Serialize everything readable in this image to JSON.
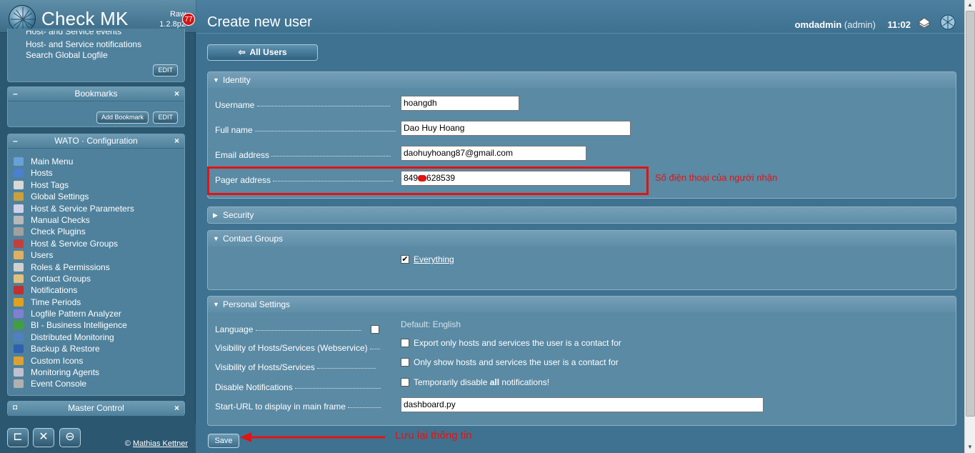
{
  "app": {
    "logo_text": "Check MK",
    "version_line1": "Raw",
    "version_line2": "1.2.8p2",
    "badge_count": "77"
  },
  "sidebar": {
    "top_snapin": {
      "cut_line": "Host- and Service events",
      "lines": [
        "Host- and Service notifications",
        "Search Global Logfile"
      ],
      "edit_label": "EDIT"
    },
    "bookmarks": {
      "title": "Bookmarks",
      "add_label": "Add Bookmark",
      "edit_label": "EDIT"
    },
    "wato": {
      "title": "WATO · Configuration",
      "items": [
        {
          "label": "Main Menu",
          "color": "#6aa0d8"
        },
        {
          "label": "Hosts",
          "color": "#4c7fd0"
        },
        {
          "label": "Host Tags",
          "color": "#d8d8d8"
        },
        {
          "label": "Global Settings",
          "color": "#c8a040"
        },
        {
          "label": "Host & Service Parameters",
          "color": "#d0d0e8"
        },
        {
          "label": "Manual Checks",
          "color": "#b8b8b8"
        },
        {
          "label": "Check Plugins",
          "color": "#a0a0a0"
        },
        {
          "label": "Host & Service Groups",
          "color": "#c04040"
        },
        {
          "label": "Users",
          "color": "#e0b060"
        },
        {
          "label": "Roles & Permissions",
          "color": "#d0d0d0"
        },
        {
          "label": "Contact Groups",
          "color": "#e0c080"
        },
        {
          "label": "Notifications",
          "color": "#c03030"
        },
        {
          "label": "Time Periods",
          "color": "#e0a020"
        },
        {
          "label": "Logfile Pattern Analyzer",
          "color": "#8080d0"
        },
        {
          "label": "BI - Business Intelligence",
          "color": "#40a040"
        },
        {
          "label": "Distributed Monitoring",
          "color": "#5080c0"
        },
        {
          "label": "Backup & Restore",
          "color": "#3060b0"
        },
        {
          "label": "Custom Icons",
          "color": "#e0a030"
        },
        {
          "label": "Monitoring Agents",
          "color": "#c0c0d0"
        },
        {
          "label": "Event Console",
          "color": "#b0b0b0"
        }
      ]
    },
    "master_control": {
      "title": "Master Control"
    },
    "footer": {
      "copyright_symbol": "©",
      "copyright_name": "Mathias Kettner"
    }
  },
  "header": {
    "page_title": "Create new user",
    "username": "omdadmin",
    "role": "(admin)",
    "time": "11:02"
  },
  "nav": {
    "all_users_label": "All Users"
  },
  "identity": {
    "title": "Identity",
    "fields": {
      "username": {
        "label": "Username",
        "value": "hoangdh"
      },
      "fullname": {
        "label": "Full name",
        "value": "Dao Huy Hoang"
      },
      "email": {
        "label": "Email address",
        "value": "daohuyhoang87@gmail.com"
      },
      "pager": {
        "label": "Pager address",
        "value_prefix": "849",
        "value_suffix": "628539"
      }
    },
    "pager_note": "Số điện thoại của người nhận"
  },
  "security": {
    "title": "Security"
  },
  "contact_groups": {
    "title": "Contact Groups",
    "option_label": "Everything",
    "checked": true
  },
  "personal_settings": {
    "title": "Personal Settings",
    "language": {
      "label": "Language",
      "default_text": "Default: English"
    },
    "visibility_ws": {
      "label": "Visibility of Hosts/Services (Webservice)",
      "option": "Export only hosts and services the user is a contact for"
    },
    "visibility": {
      "label": "Visibility of Hosts/Services",
      "option": "Only show hosts and services the user is a contact for"
    },
    "disable_notif": {
      "label": "Disable Notifications",
      "option_pre": "Temporarily disable ",
      "option_bold": "all",
      "option_post": " notifications!"
    },
    "start_url": {
      "label": "Start-URL to display in main frame",
      "value": "dashboard.py"
    }
  },
  "actions": {
    "save_label": "Save",
    "save_note": "Lưu lại thông tin"
  },
  "colors": {
    "annotation_red": "#e01414",
    "section_bg": "#5a8aa4"
  }
}
